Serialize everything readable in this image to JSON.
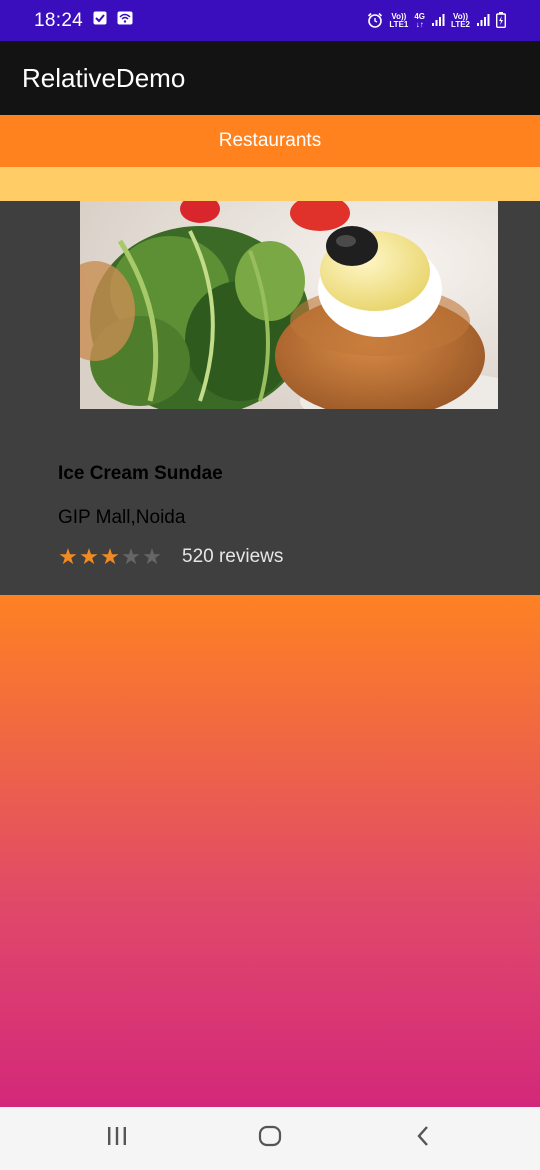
{
  "status_bar": {
    "time": "18:24",
    "left_icons": [
      "check-notification-icon",
      "wifi-calling-icon"
    ],
    "right_icons": [
      "alarm-icon",
      "volte-lte1-icon",
      "4g-icon",
      "signal-icon",
      "volte-lte2-icon",
      "signal-icon",
      "battery-charging-icon"
    ],
    "net1_top": "Vo))",
    "net1_bottom": "LTE1",
    "net2_top": "4G",
    "net2_bottom": "↓↑",
    "net3_top": "Vo))",
    "net3_bottom": "LTE2"
  },
  "app_bar": {
    "title": "RelativeDemo"
  },
  "header": {
    "label": "Restaurants"
  },
  "card": {
    "image_icon": "food-photo",
    "title": "Ice Cream Sundae",
    "location": "GIP Mall,Noida",
    "rating": 3,
    "rating_max": 5,
    "reviews": "520 reviews"
  },
  "colors": {
    "status_bar": "#3a0dbd",
    "app_bar": "#131313",
    "accent_orange": "#ff821f",
    "yellow_strip": "#ffcc66",
    "card_bg": "#3f3f3f",
    "gradient_bottom": "#d3287a",
    "star_filled": "#f28a22",
    "star_empty": "#666666"
  },
  "nav_bar": {
    "buttons": [
      "recent-apps-icon",
      "home-icon",
      "back-icon"
    ]
  }
}
